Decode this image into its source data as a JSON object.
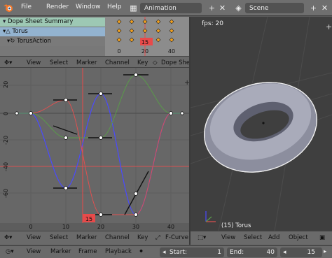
{
  "topbar": {
    "menus": [
      "File",
      "Render",
      "Window",
      "Help"
    ],
    "screen_layout": "Animation",
    "scene": "Scene"
  },
  "dopesheet": {
    "channels": [
      "Dope Sheet Summary",
      "Torus",
      "TorusAction"
    ],
    "frame_ticks": [
      "0",
      "20",
      "40"
    ],
    "current_frame": "15"
  },
  "dope_header": {
    "menus": [
      "View",
      "Select",
      "Marker",
      "Channel",
      "Key"
    ],
    "mode": "Dope Shee"
  },
  "graph": {
    "y_ticks": [
      "20",
      "0",
      "-20",
      "-40",
      "-60"
    ],
    "x_ticks": [
      "0",
      "10",
      "20",
      "30",
      "40"
    ],
    "current_frame": "15"
  },
  "graph_header": {
    "menus": [
      "View",
      "Select",
      "Marker",
      "Channel",
      "Key"
    ],
    "mode": "F-Curve"
  },
  "viewport": {
    "fps": "fps: 20",
    "object_label": "(15) Torus"
  },
  "view_header": {
    "menus": [
      "View",
      "Select",
      "Add",
      "Object"
    ]
  },
  "timeline": {
    "menus": [
      "View",
      "Marker",
      "Frame",
      "Playback"
    ],
    "start_label": "Start:",
    "start_value": "1",
    "end_label": "End:",
    "end_value": "40",
    "current": "15"
  },
  "colors": {
    "curve_x": "#e05050",
    "curve_y": "#5a9a4a",
    "curve_z": "#4a4aff",
    "playhead": "#e84a4a",
    "keyframe": "#f0a020"
  }
}
